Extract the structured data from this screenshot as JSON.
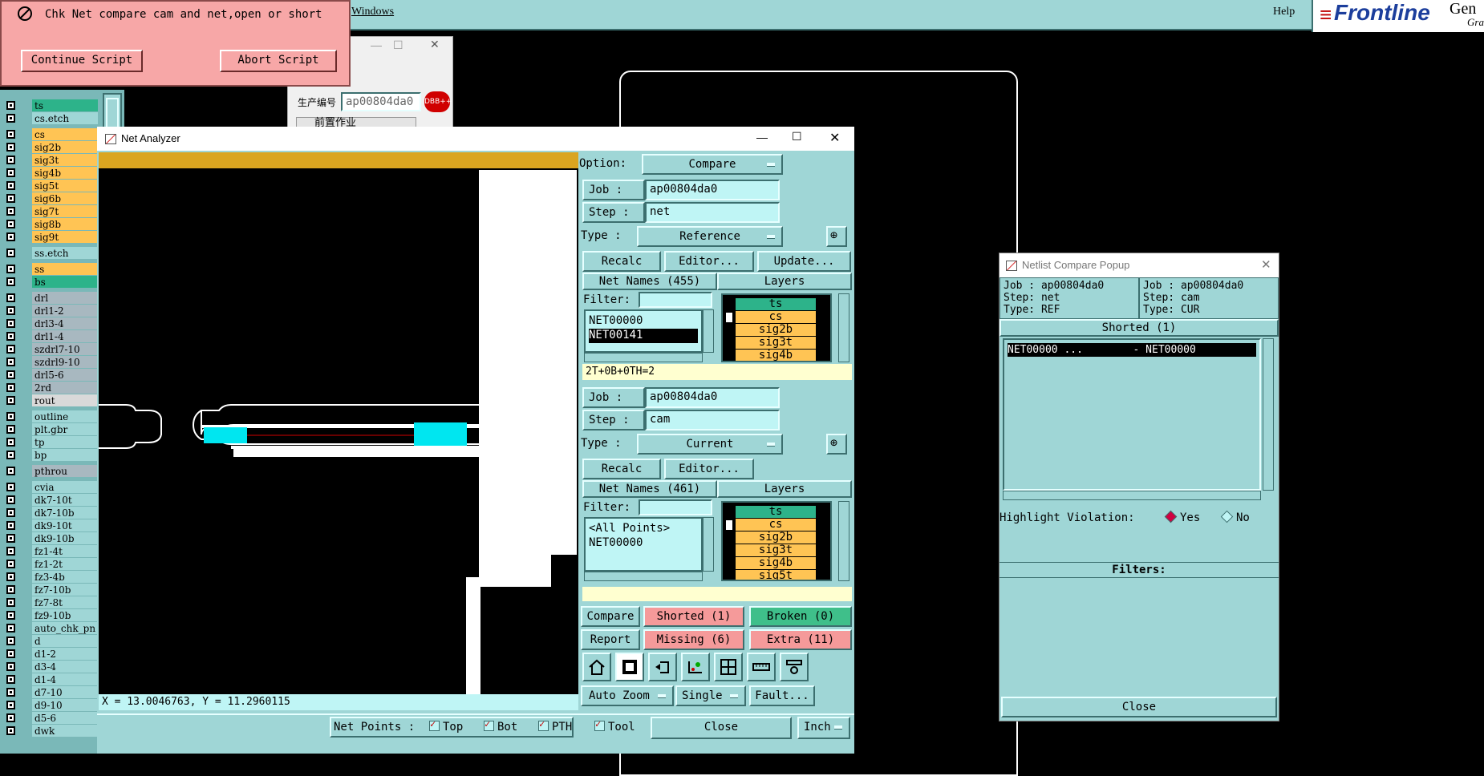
{
  "topbar": {
    "windows_menu": "Windows",
    "help_menu": "Help",
    "brand": "Frontline",
    "brand_partial": "Gen",
    "brand_sub": "Gra"
  },
  "script_popup": {
    "message": "Chk Net compare cam and net,open or short",
    "continue_label": "Continue Script",
    "abort_label": "Abort Script"
  },
  "bg_window": {
    "label": "生产编号",
    "value": "ap00804da0",
    "section": "前置作业",
    "badge": "DBB++"
  },
  "layers": [
    {
      "name": "ts",
      "color": "#2db38a"
    },
    {
      "name": "cs.etch",
      "color": "#9fd6d6"
    },
    {
      "name": "cs",
      "color": "#ffc454"
    },
    {
      "name": "sig2b",
      "color": "#ffc454"
    },
    {
      "name": "sig3t",
      "color": "#ffc454"
    },
    {
      "name": "sig4b",
      "color": "#ffc454"
    },
    {
      "name": "sig5t",
      "color": "#ffc454"
    },
    {
      "name": "sig6b",
      "color": "#ffc454"
    },
    {
      "name": "sig7t",
      "color": "#ffc454"
    },
    {
      "name": "sig8b",
      "color": "#ffc454"
    },
    {
      "name": "sig9t",
      "color": "#ffc454"
    },
    {
      "name": "ss.etch",
      "color": "#9fd6d6"
    },
    {
      "name": "ss",
      "color": "#ffc454"
    },
    {
      "name": "bs",
      "color": "#2db38a"
    },
    {
      "name": "drl",
      "color": "#a8b8c0"
    },
    {
      "name": "drl1-2",
      "color": "#a8b8c0"
    },
    {
      "name": "drl3-4",
      "color": "#a8b8c0"
    },
    {
      "name": "drl1-4",
      "color": "#a8b8c0"
    },
    {
      "name": "szdrl7-10",
      "color": "#a8b8c0"
    },
    {
      "name": "szdrl9-10",
      "color": "#a8b8c0"
    },
    {
      "name": "drl5-6",
      "color": "#a8b8c0"
    },
    {
      "name": "2rd",
      "color": "#a8b8c0"
    },
    {
      "name": "rout",
      "color": "#d9d9d9"
    },
    {
      "name": "outline",
      "color": "#9fd6d6"
    },
    {
      "name": "plt.gbr",
      "color": "#9fd6d6"
    },
    {
      "name": "tp",
      "color": "#9fd6d6"
    },
    {
      "name": "bp",
      "color": "#9fd6d6"
    },
    {
      "name": "pthrou",
      "color": "#a8b8c0"
    },
    {
      "name": "cvia",
      "color": "#9fd6d6"
    },
    {
      "name": "dk7-10t",
      "color": "#9fd6d6"
    },
    {
      "name": "dk7-10b",
      "color": "#9fd6d6"
    },
    {
      "name": "dk9-10t",
      "color": "#9fd6d6"
    },
    {
      "name": "dk9-10b",
      "color": "#9fd6d6"
    },
    {
      "name": "fz1-4t",
      "color": "#9fd6d6"
    },
    {
      "name": "fz1-2t",
      "color": "#9fd6d6"
    },
    {
      "name": "fz3-4b",
      "color": "#9fd6d6"
    },
    {
      "name": "fz7-10b",
      "color": "#9fd6d6"
    },
    {
      "name": "fz7-8t",
      "color": "#9fd6d6"
    },
    {
      "name": "fz9-10b",
      "color": "#9fd6d6"
    },
    {
      "name": "auto_chk_pn",
      "color": "#9fd6d6"
    },
    {
      "name": "d",
      "color": "#9fd6d6"
    },
    {
      "name": "d1-2",
      "color": "#9fd6d6"
    },
    {
      "name": "d3-4",
      "color": "#9fd6d6"
    },
    {
      "name": "d1-4",
      "color": "#9fd6d6"
    },
    {
      "name": "d7-10",
      "color": "#9fd6d6"
    },
    {
      "name": "d9-10",
      "color": "#9fd6d6"
    },
    {
      "name": "d5-6",
      "color": "#9fd6d6"
    },
    {
      "name": "dwk",
      "color": "#9fd6d6"
    }
  ],
  "net_analyzer": {
    "title": "Net Analyzer",
    "coords": "X = 13.0046763, Y = 11.2960115",
    "option_label": "Option:",
    "option_value": "Compare",
    "job_label": "Job  :",
    "step_label": "Step  :",
    "type_label": "Type  :",
    "filter_label": "Filter:",
    "recalc": "Recalc",
    "editor": "Editor...",
    "update": "Update...",
    "layers_header": "Layers",
    "ref": {
      "job": "ap00804da0",
      "step": "net",
      "type": "Reference",
      "net_names_header": "Net Names (455)",
      "nets": [
        "NET00000",
        "NET00141"
      ],
      "layers": [
        "ts",
        "cs",
        "sig2b",
        "sig3t",
        "sig4b"
      ],
      "summary": "2T+0B+0TH=2"
    },
    "cur": {
      "job": "ap00804da0",
      "step": "cam",
      "type": "Current",
      "net_names_header": "Net Names (461)",
      "nets": [
        "<All Points>",
        "NET00000"
      ],
      "layers": [
        "ts",
        "cs",
        "sig2b",
        "sig3t",
        "sig4b",
        "sig5t"
      ]
    },
    "compare": "Compare",
    "report": "Report",
    "shorted": "Shorted (1)",
    "broken": "Broken (0)",
    "missing": "Missing (6)",
    "extra": "Extra (11)",
    "auto_zoom": "Auto Zoom",
    "single": "Single",
    "fault": "Fault...",
    "net_points_label": "Net Points :",
    "np_top": "Top",
    "np_bot": "Bot",
    "np_pth": "PTH",
    "np_tool": "Tool",
    "close": "Close",
    "units": "Inch"
  },
  "netlist_popup": {
    "title": "Netlist Compare Popup",
    "left": {
      "job": "Job : ap00804da0",
      "step": "Step: net",
      "type": "Type: REF"
    },
    "right": {
      "job": "Job : ap00804da0",
      "step": "Step: cam",
      "type": "Type: CUR"
    },
    "shorted_header": "Shorted (1)",
    "row": "NET00000 ...        - NET00000",
    "highlight_label": "Highlight Violation:",
    "yes": "Yes",
    "no": "No",
    "filters_label": "Filters:",
    "close": "Close"
  }
}
